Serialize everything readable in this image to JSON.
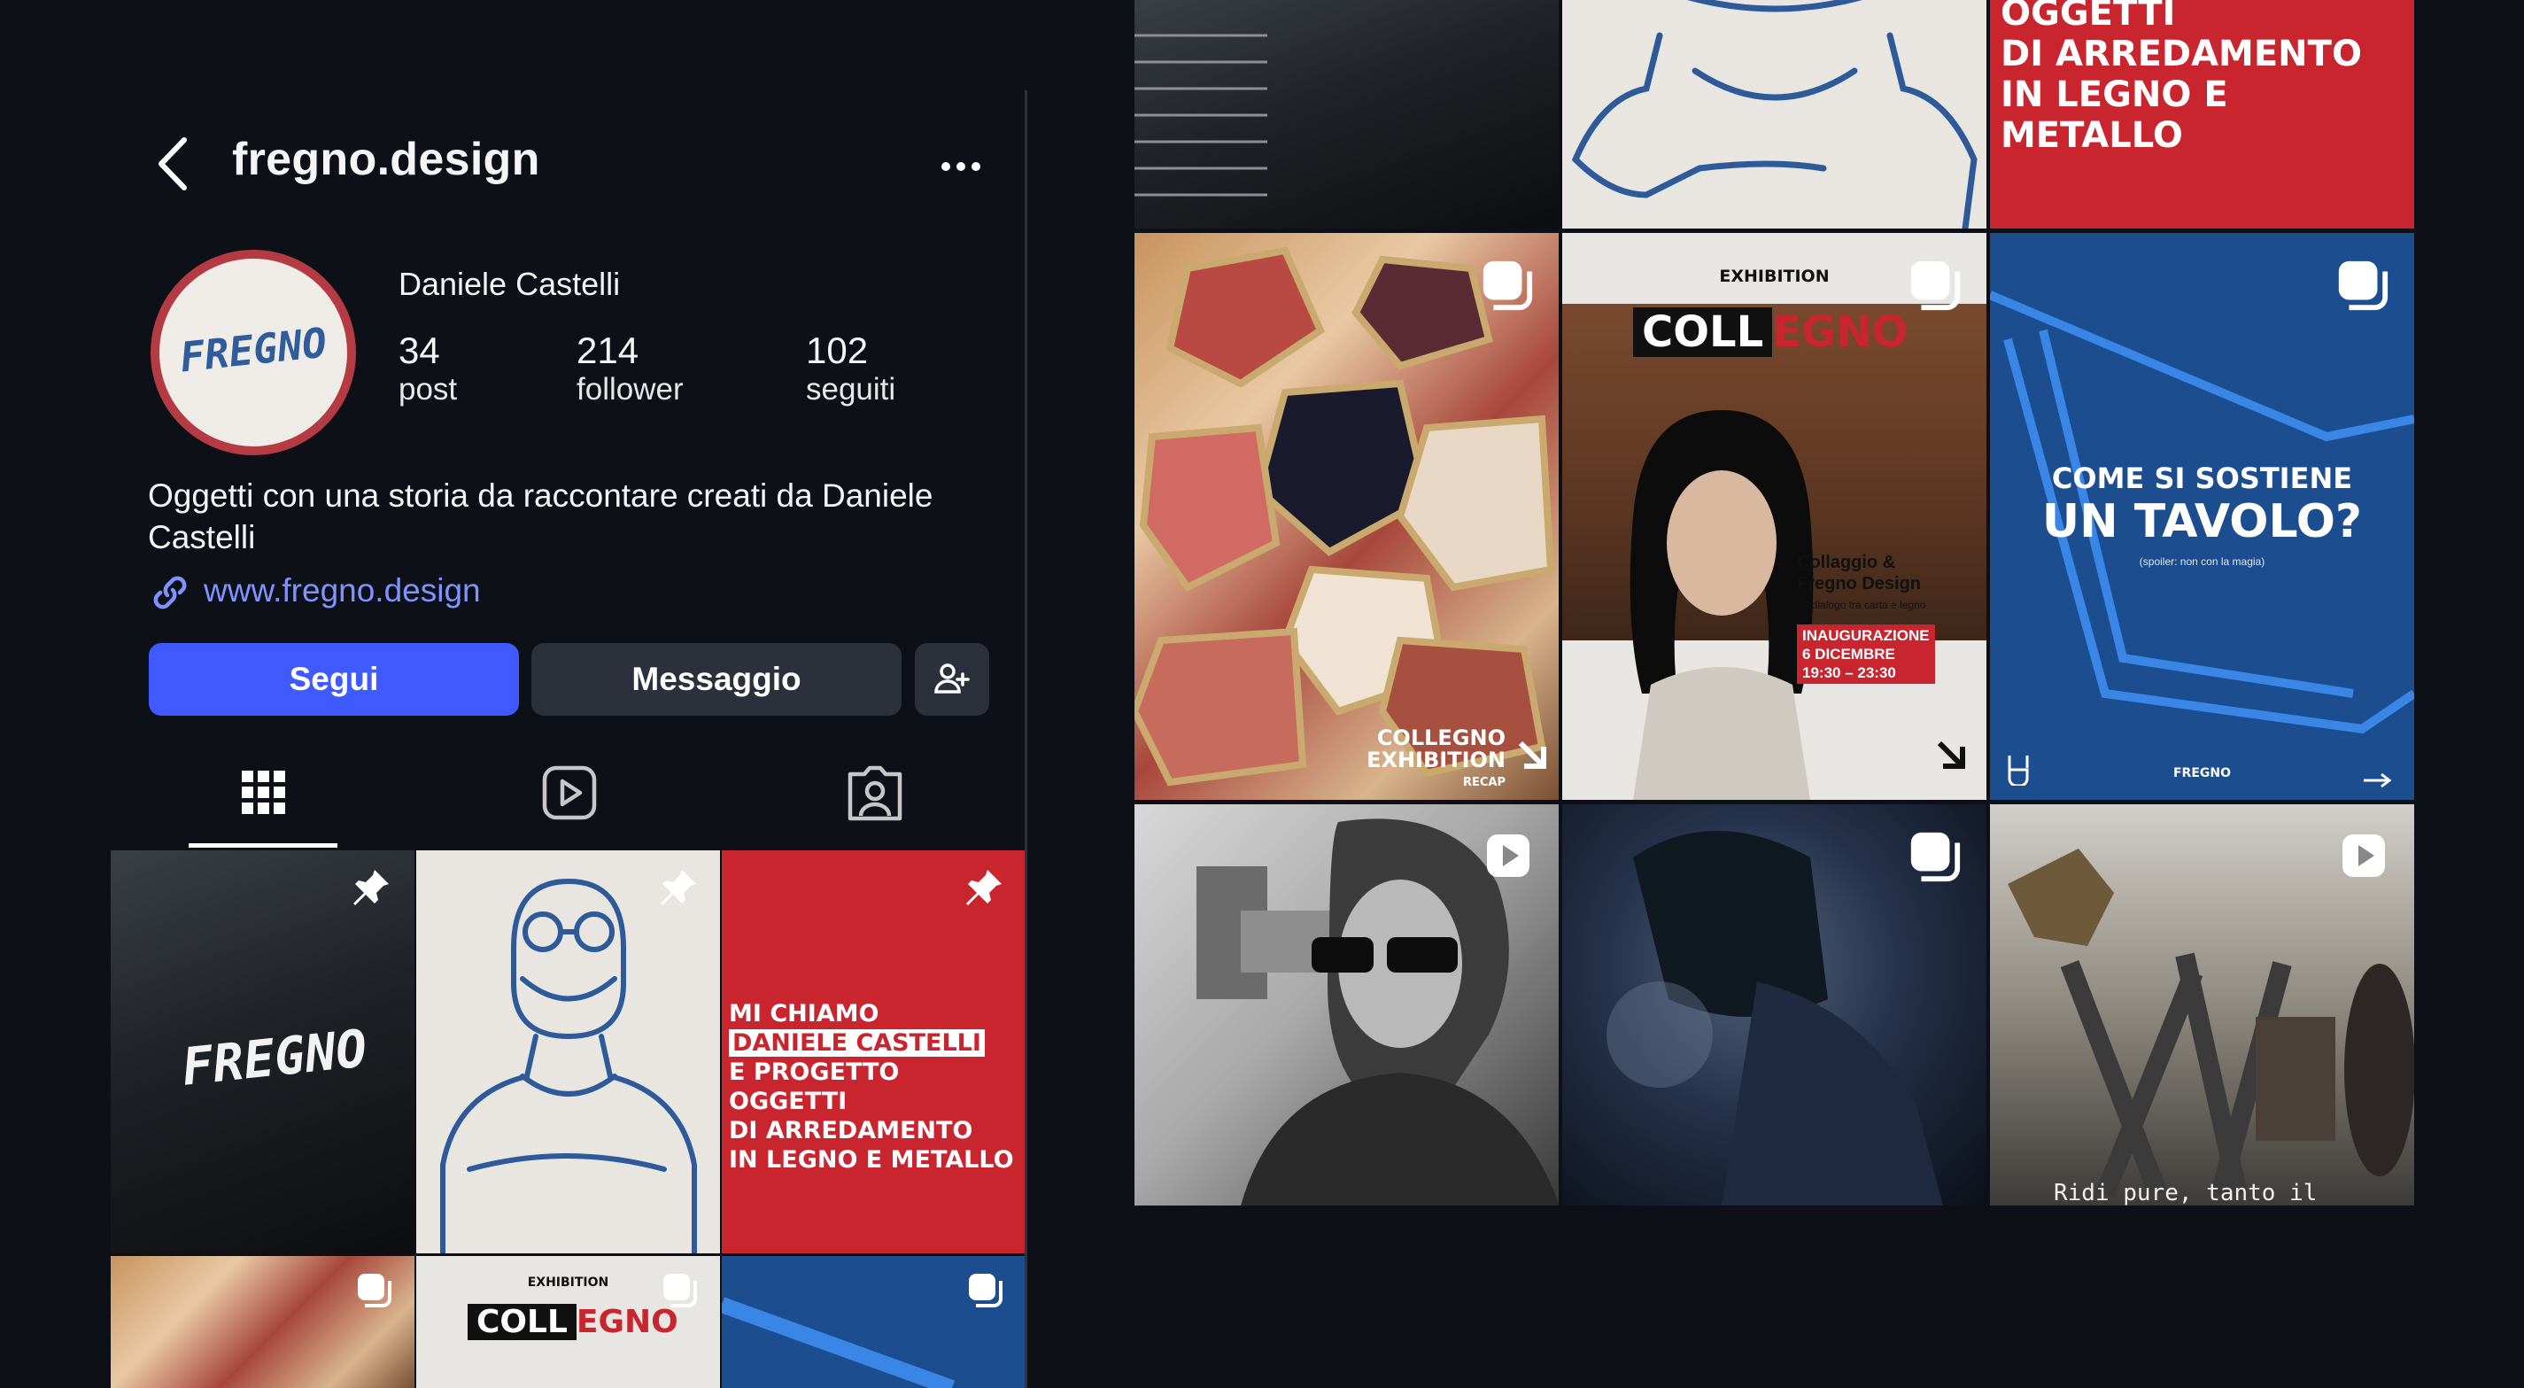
{
  "profile": {
    "username": "fregno.design",
    "avatar_text": "FREGNO",
    "full_name": "Daniele Castelli",
    "stats": [
      {
        "value": "34",
        "label": "post"
      },
      {
        "value": "214",
        "label": "follower"
      },
      {
        "value": "102",
        "label": "seguiti"
      }
    ],
    "bio": "Oggetti con una storia da raccontare creati da Daniele Castelli",
    "link": "www.fregno.design"
  },
  "buttons": {
    "follow": "Segui",
    "message": "Messaggio"
  },
  "tiles": {
    "fregno_logo": "FREGNO",
    "intro_lines": [
      "MI CHIAMO",
      "DANIELE CASTELLI",
      "E PROGETTO",
      "OGGETTI",
      "DI ARREDAMENTO",
      "IN LEGNO E METALLO"
    ],
    "intro_top_lines": [
      "OGGETTI",
      "DI ARREDAMENTO",
      "IN LEGNO E METALLO"
    ],
    "collage_caption": [
      "COLLEGNO",
      "EXHIBITION"
    ],
    "collage_sub": "RECAP",
    "exhibition_label": "EXHIBITION",
    "exhibition_title_a": "COLL",
    "exhibition_title_b": "EGNO",
    "exhibition_sub": [
      "Collaggio &",
      "Fregno Design"
    ],
    "exhibition_tag": "un dialogo tra carta e legno",
    "exhibition_date": [
      "INAUGURAZIONE",
      "6 DICEMBRE",
      "19:30 – 23:30"
    ],
    "tavolo_line1": "COME SI SOSTIENE",
    "tavolo_line2": "UN TAVOLO?",
    "tavolo_note": "(spoiler: non con la magia)",
    "tavolo_brand": "FREGNO",
    "workshop_caption": "Ridi pure, tanto il"
  },
  "colors": {
    "background": "#0d1117",
    "accent": "#3f5bff",
    "link": "#7f93ff",
    "brand_red": "#c8252f",
    "brand_blue": "#1c4d8e"
  }
}
